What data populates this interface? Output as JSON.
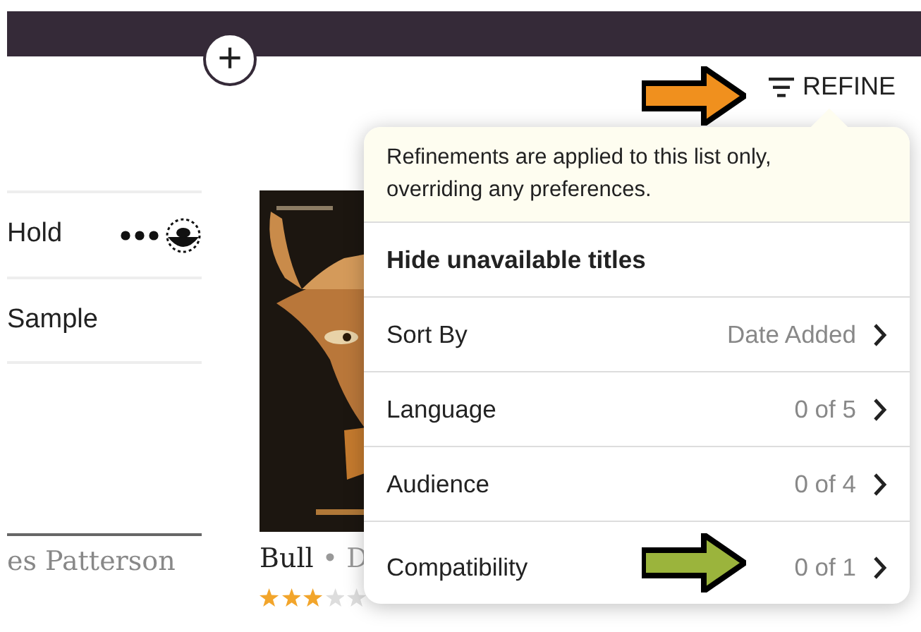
{
  "header": {
    "add_button": "+",
    "refine_button": "REFINE"
  },
  "list_actions": [
    {
      "label": "Hold",
      "has_menu": true
    },
    {
      "label": "Sample",
      "has_menu": false
    }
  ],
  "left_author": "es Patterson",
  "book": {
    "kind": "picture",
    "title": "Bull",
    "separator": "•",
    "author": "D",
    "stars": 3
  },
  "refine_popover": {
    "note": "Refinements are applied to this list only, overriding any preferences.",
    "rows": [
      {
        "kind": "toggle",
        "label": "Hide unavailable titles"
      },
      {
        "kind": "nav",
        "label": "Sort By",
        "value": "Date Added"
      },
      {
        "kind": "nav",
        "label": "Language",
        "value": "0 of 5"
      },
      {
        "kind": "nav",
        "label": "Audience",
        "value": "0 of 4"
      },
      {
        "kind": "nav",
        "label": "Compatibility",
        "value": "0 of 1"
      }
    ]
  },
  "annotations": [
    {
      "color": "#f0901e"
    },
    {
      "color": "#9bb43c"
    }
  ]
}
